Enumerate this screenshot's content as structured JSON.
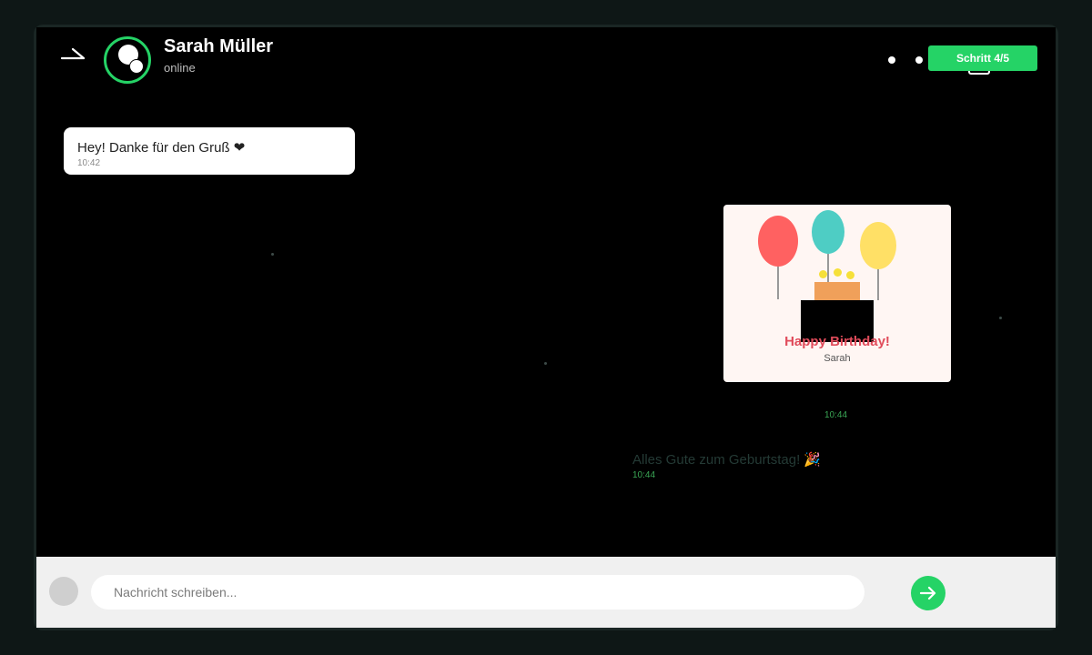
{
  "header": {
    "contact_name": "Sarah Müller",
    "status": "online",
    "step_badge": "Schritt 4/5"
  },
  "messages": [
    {
      "direction": "incoming",
      "text": "Hey! Danke für den Gruß ❤",
      "time": "10:42"
    },
    {
      "direction": "outgoing",
      "type": "card",
      "card_title": "Happy Birthday!",
      "card_subtitle": "Sarah",
      "time": "10:44"
    },
    {
      "direction": "outgoing",
      "text": "Alles Gute zum Geburtstag! 🎉",
      "time": "10:44"
    }
  ],
  "composer": {
    "placeholder": "Nachricht schreiben..."
  },
  "colors": {
    "accent": "#25d366",
    "chat_background": "#000000",
    "incoming_bubble": "#ffffff",
    "card_title": "#e04b5a",
    "timestamp_out": "#3aa655"
  },
  "icons": {
    "back": "arrow-back-icon",
    "video": "video-call-icon",
    "send": "send-arrow-icon",
    "attach": "attach-icon"
  }
}
